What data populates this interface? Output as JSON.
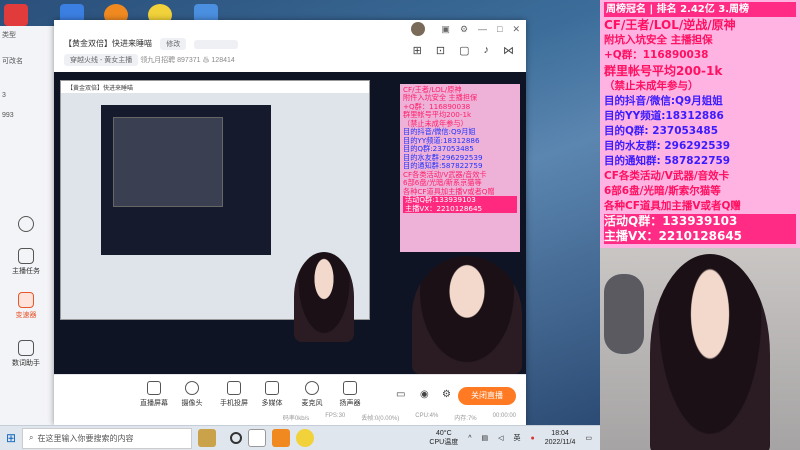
{
  "desktop": {
    "icons": [
      "app-red",
      "app-blue",
      "app-orange",
      "app-yellow",
      "app-cloud"
    ]
  },
  "left_pane": {
    "tab_label": "类型",
    "short_label": "可改名",
    "numbers": [
      "3",
      "993"
    ],
    "items": [
      {
        "label": "主播任务",
        "icon": "clipboard-icon"
      },
      {
        "label": "变速器",
        "icon": "gear-icon"
      },
      {
        "label": "数词助手",
        "icon": "list-icon"
      }
    ]
  },
  "app": {
    "room_title": "【黄金双倍】快进来睡喵",
    "edit_chip": "修改",
    "category": "穿越火线 - 黄女主播",
    "follow_label": "领九月招聘",
    "viewers": "897371",
    "hot": "128414",
    "controls": [
      {
        "label": "直播屏幕",
        "icon": "screen-icon"
      },
      {
        "label": "摄像头",
        "icon": "camera-icon"
      },
      {
        "label": "手机投屏",
        "icon": "phone-icon"
      },
      {
        "label": "多媒体",
        "icon": "media-icon"
      },
      {
        "label": "麦克风",
        "icon": "mic-icon"
      },
      {
        "label": "扬声器",
        "icon": "speaker-icon"
      }
    ],
    "end_button": "关闭直播",
    "stats": [
      "码率0kb/s",
      "FPS:30",
      "丢帧:0(0.00%)",
      "CPU:4%",
      "内存:7%",
      "00:00:00"
    ]
  },
  "overlay_small": {
    "lines": [
      "CF/王者/LOL/原神",
      "附件入坑安全 主播担保",
      "+Q群：116890038",
      "群里帐号平均200-1k",
      "（禁止未成年参与）",
      "目的抖音/微信:Q9月姐",
      "目的YY频道:18312886",
      "目的Q群:237053485",
      "目的水友群:296292539",
      "目的通知群:587822759",
      "CF各类活动/V武器/音效卡",
      "6部6盘/光暗/斯系京猫等",
      "各种CF道具加主播V或者Q赠",
      "活动Q群:133939103",
      "主播VX：2210128645"
    ]
  },
  "overlay_right": {
    "head": "周榜冠名 | 排名 2.42亿 3.周榜",
    "lines": [
      {
        "text": "CF/王者/LOL/逆战/原神",
        "kind": "normal"
      },
      {
        "text": "附坑入坑安全 主播担保",
        "kind": "normal"
      },
      {
        "text": "+Q群：116890038",
        "kind": "normal"
      },
      {
        "text": "群里帐号平均200-1k",
        "kind": "normal"
      },
      {
        "text": "（禁止未成年参与）",
        "kind": "normal"
      },
      {
        "text": "目的抖音/微信:Q9月姐姐",
        "kind": "hl"
      },
      {
        "text": "目的YY频道:18312886",
        "kind": "hl"
      },
      {
        "text": "目的Q群:   237053485",
        "kind": "hl"
      },
      {
        "text": "目的水友群:  296292539",
        "kind": "hl"
      },
      {
        "text": "目的通知群:  587822759",
        "kind": "hl"
      },
      {
        "text": "CF各类活动/V武器/音效卡",
        "kind": "normal"
      },
      {
        "text": "6部6盘/光暗/斯索尔猫等",
        "kind": "normal"
      },
      {
        "text": "各种CF道具加主播V或者Q赠",
        "kind": "normal"
      },
      {
        "text": "活动Q群：133939103",
        "kind": "cta"
      },
      {
        "text": "主播VX：2210128645",
        "kind": "cta"
      }
    ]
  },
  "taskbar": {
    "search_placeholder": "在这里输入你要搜索的内容",
    "temp": "40°C",
    "temp_label": "CPU温度",
    "ime": "英",
    "time": "18:04",
    "date": "2022/11/4"
  }
}
